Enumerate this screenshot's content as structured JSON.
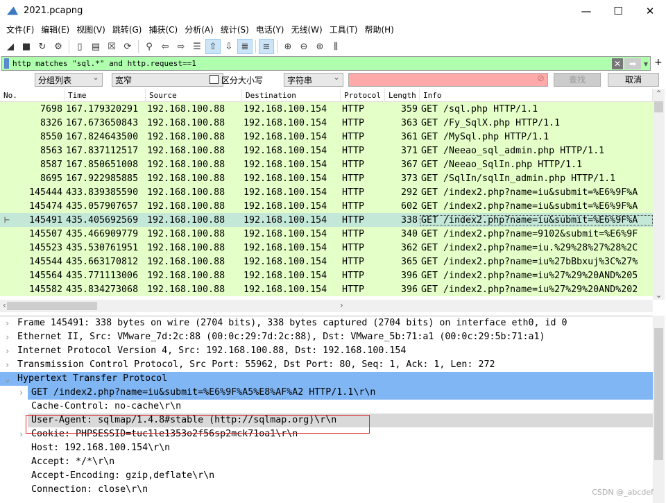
{
  "window": {
    "title": "2021.pcapng",
    "min": "—",
    "max": "☐",
    "close": "✕"
  },
  "menu": [
    "文件(F)",
    "编辑(E)",
    "视图(V)",
    "跳转(G)",
    "捕获(C)",
    "分析(A)",
    "统计(S)",
    "电话(Y)",
    "无线(W)",
    "工具(T)",
    "帮助(H)"
  ],
  "toolbar": [
    {
      "icon": "shark-fin-start-icon",
      "glyph": "◢"
    },
    {
      "icon": "stop-icon",
      "glyph": "■"
    },
    {
      "icon": "restart-icon",
      "glyph": "↻"
    },
    {
      "icon": "capture-options-icon",
      "glyph": "⚙"
    },
    "sep",
    {
      "icon": "open-file-icon",
      "glyph": "▯"
    },
    {
      "icon": "file-icon",
      "glyph": "▤"
    },
    {
      "icon": "close-file-icon",
      "glyph": "☒"
    },
    {
      "icon": "reload-icon",
      "glyph": "⟳"
    },
    "sep",
    {
      "icon": "find-icon",
      "glyph": "⚲"
    },
    {
      "icon": "back-icon",
      "glyph": "⇦"
    },
    {
      "icon": "forward-icon",
      "glyph": "⇨"
    },
    {
      "icon": "go-to-packet-icon",
      "glyph": "☰"
    },
    {
      "icon": "first-packet-icon",
      "glyph": "⇧",
      "on": true
    },
    {
      "icon": "last-packet-icon",
      "glyph": "⇩"
    },
    {
      "icon": "autoscroll-icon",
      "glyph": "≣",
      "on": true
    },
    "sep",
    {
      "icon": "colorize-icon",
      "glyph": "≡",
      "on": true
    },
    "sep",
    {
      "icon": "zoom-in-icon",
      "glyph": "⊕"
    },
    {
      "icon": "zoom-out-icon",
      "glyph": "⊖"
    },
    {
      "icon": "zoom-normal-icon",
      "glyph": "⊜"
    },
    {
      "icon": "resize-columns-icon",
      "glyph": "⫼"
    }
  ],
  "filter": {
    "value": "http matches \"sql.*\" and http.request==1",
    "clear": "✕",
    "apply": "➡",
    "dropdown": "▾",
    "add": "+"
  },
  "find": {
    "scope": "分组列表",
    "width": "宽窄",
    "case_label": "区分大小写",
    "type": "字符串",
    "search_value": "",
    "find_btn": "查找",
    "cancel_btn": "取消",
    "accent": "#ffaaaa"
  },
  "columns": [
    "No.",
    "Time",
    "Source",
    "Destination",
    "Protocol",
    "Length",
    "Info"
  ],
  "packets": [
    [
      "7698",
      "167.179320291",
      "192.168.100.88",
      "192.168.100.154",
      "HTTP",
      "359",
      "GET /sql.php HTTP/1.1"
    ],
    [
      "8326",
      "167.673650843",
      "192.168.100.88",
      "192.168.100.154",
      "HTTP",
      "363",
      "GET /Fy_SqlX.php HTTP/1.1"
    ],
    [
      "8550",
      "167.824643500",
      "192.168.100.88",
      "192.168.100.154",
      "HTTP",
      "361",
      "GET /MySql.php HTTP/1.1"
    ],
    [
      "8563",
      "167.837112517",
      "192.168.100.88",
      "192.168.100.154",
      "HTTP",
      "371",
      "GET /Neeao_sql_admin.php HTTP/1.1"
    ],
    [
      "8587",
      "167.850651008",
      "192.168.100.88",
      "192.168.100.154",
      "HTTP",
      "367",
      "GET /Neeao_SqlIn.php HTTP/1.1"
    ],
    [
      "8695",
      "167.922985885",
      "192.168.100.88",
      "192.168.100.154",
      "HTTP",
      "373",
      "GET /SqlIn/sqlIn_admin.php HTTP/1.1"
    ],
    [
      "145444",
      "433.839385590",
      "192.168.100.88",
      "192.168.100.154",
      "HTTP",
      "292",
      "GET /index2.php?name=iu&submit=%E6%9F%A"
    ],
    [
      "145474",
      "435.057907657",
      "192.168.100.88",
      "192.168.100.154",
      "HTTP",
      "602",
      "GET /index2.php?name=iu&submit=%E6%9F%A"
    ],
    [
      "145491",
      "435.405692569",
      "192.168.100.88",
      "192.168.100.154",
      "HTTP",
      "338",
      "GET /index2.php?name=iu&submit=%E6%9F%A"
    ],
    [
      "145507",
      "435.466909779",
      "192.168.100.88",
      "192.168.100.154",
      "HTTP",
      "340",
      "GET /index2.php?name=9102&submit=%E6%9F"
    ],
    [
      "145523",
      "435.530761951",
      "192.168.100.88",
      "192.168.100.154",
      "HTTP",
      "362",
      "GET /index2.php?name=iu.%29%28%27%28%2C"
    ],
    [
      "145544",
      "435.663170812",
      "192.168.100.88",
      "192.168.100.154",
      "HTTP",
      "365",
      "GET /index2.php?name=iu%27bBbxuj%3C%27%"
    ],
    [
      "145564",
      "435.771113006",
      "192.168.100.88",
      "192.168.100.154",
      "HTTP",
      "396",
      "GET /index2.php?name=iu%27%29%20AND%205"
    ],
    [
      "145582",
      "435.834273068",
      "192.168.100.88",
      "192.168.100.154",
      "HTTP",
      "396",
      "GET /index2.php?name=iu%27%29%20AND%202"
    ]
  ],
  "selected_packet": "145491",
  "details": [
    {
      "text": "Frame 145491: 338 bytes on wire (2704 bits), 338 bytes captured (2704 bits) on interface eth0, id 0",
      "level": 0,
      "arrow": "›"
    },
    {
      "text": "Ethernet II, Src: VMware_7d:2c:88 (00:0c:29:7d:2c:88), Dst: VMware_5b:71:a1 (00:0c:29:5b:71:a1)",
      "level": 0,
      "arrow": "›"
    },
    {
      "text": "Internet Protocol Version 4, Src: 192.168.100.88, Dst: 192.168.100.154",
      "level": 0,
      "arrow": "›"
    },
    {
      "text": "Transmission Control Protocol, Src Port: 55962, Dst Port: 80, Seq: 1, Ack: 1, Len: 272",
      "level": 0,
      "arrow": "›"
    },
    {
      "text": "Hypertext Transfer Protocol",
      "level": 0,
      "arrow": "⌄",
      "hl": "sel"
    },
    {
      "text": "GET /index2.php?name=iu&submit=%E6%9F%A5%E8%AF%A2 HTTP/1.1\\r\\n",
      "level": 1,
      "arrow": "›",
      "hl": "sub"
    },
    {
      "text": "Cache-Control: no-cache\\r\\n",
      "level": 1
    },
    {
      "text": "User-Agent: sqlmap/1.4.8#stable (http://sqlmap.org)\\r\\n",
      "level": 1,
      "hl": "gray"
    },
    {
      "text": "Cookie: PHPSESSID=tuc1le1353o2f56sp2mck71oa1\\r\\n",
      "level": 1,
      "arrow": "›"
    },
    {
      "text": "Host: 192.168.100.154\\r\\n",
      "level": 1
    },
    {
      "text": "Accept: */*\\r\\n",
      "level": 1
    },
    {
      "text": "Accept-Encoding: gzip,deflate\\r\\n",
      "level": 1
    },
    {
      "text": "Connection: close\\r\\n",
      "level": 1
    }
  ],
  "watermark": "CSDN @_abcdef"
}
